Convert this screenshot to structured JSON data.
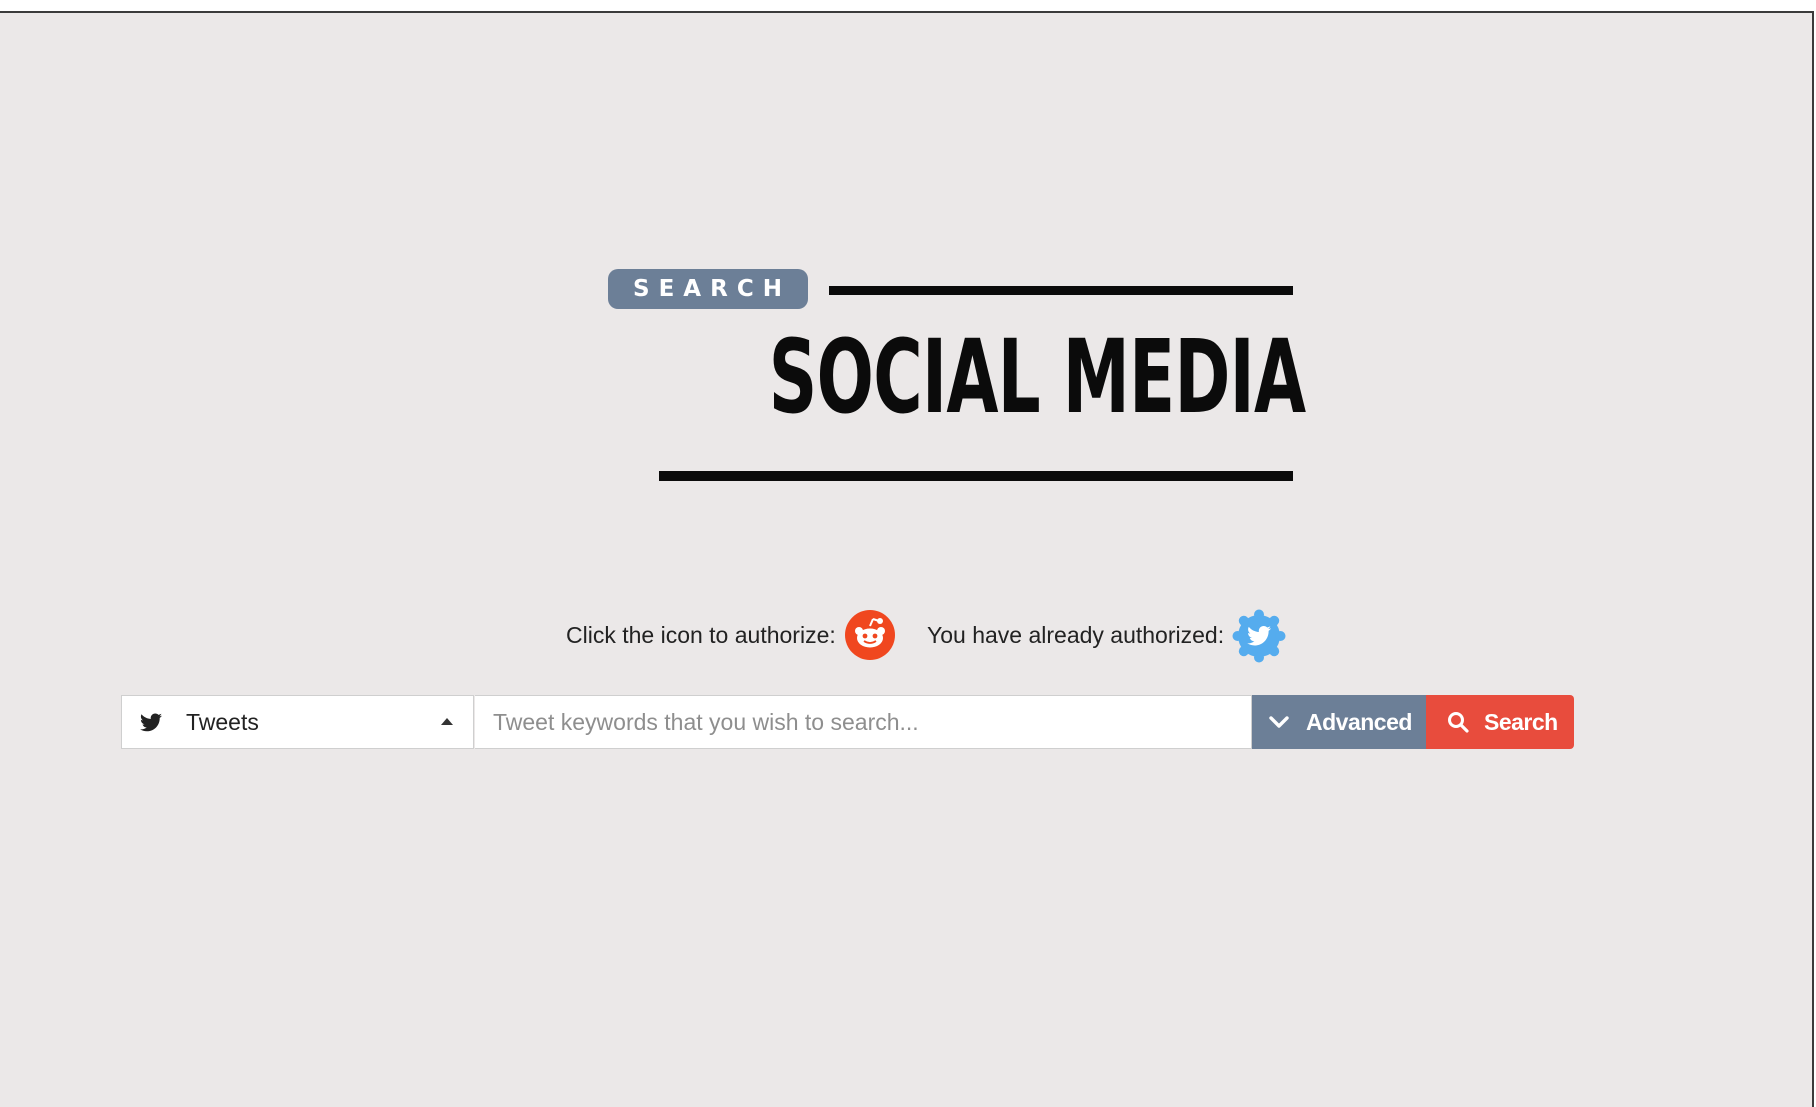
{
  "logo": {
    "badge_text": "SEARCH",
    "title": "SOCIAL MEDIA"
  },
  "auth": {
    "prompt_label": "Click the icon to authorize:",
    "prompt_icon": "reddit-icon",
    "authorized_label": "You have already authorized:",
    "authorized_icon": "twitter-icon"
  },
  "search": {
    "type_icon": "twitter-bird-icon",
    "type_selected": "Tweets",
    "placeholder": "Tweet keywords that you wish to search...",
    "value": "",
    "advanced_label": "Advanced",
    "search_label": "Search"
  },
  "colors": {
    "background": "#ebe8e8",
    "badge": "#6c7f97",
    "advanced_button": "#6c7f97",
    "search_button": "#e84c3d",
    "reddit": "#f0471f",
    "twitter": "#55acee"
  }
}
